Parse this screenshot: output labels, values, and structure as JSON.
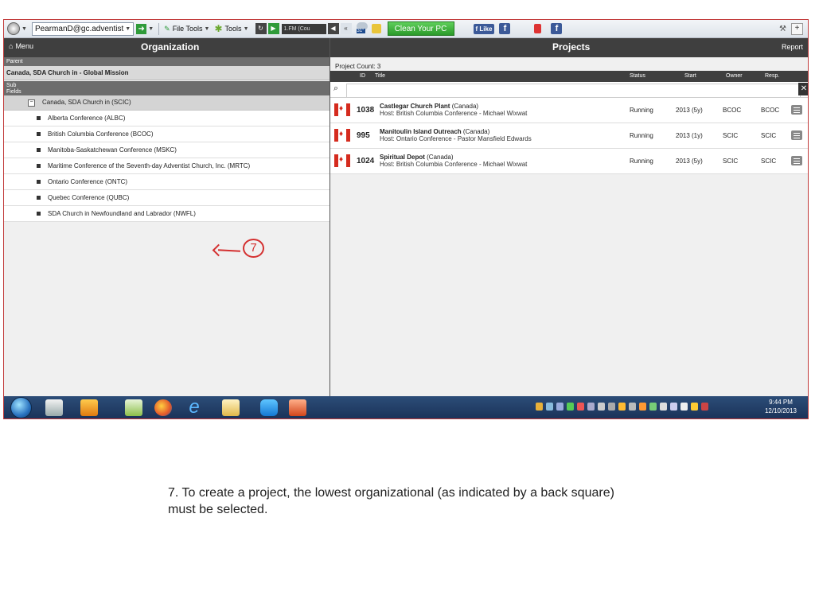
{
  "toolbar": {
    "account": "PearmanD@gc.adventist",
    "file_tools": "File Tools",
    "tools": "Tools",
    "radio": "1.FM (Cou",
    "temperature": "31°",
    "clean_pc": "Clean Your PC",
    "like": "Like"
  },
  "header": {
    "menu": "Menu",
    "organization": "Organization",
    "projects": "Projects",
    "report": "Report"
  },
  "left": {
    "parent_label": "Parent",
    "parent_value": "Canada, SDA Church in - Global Mission",
    "sub_label_1": "Sub",
    "sub_label_2": "Fields",
    "tree_parent": "Canada, SDA Church in (SCIC)",
    "items": [
      "Alberta Conference (ALBC)",
      "British Columbia Conference (BCOC)",
      "Manitoba-Saskatchewan Conference (MSKC)",
      "Maritime Conference of the Seventh-day Adventist Church, Inc. (MRTC)",
      "Ontario Conference (ONTC)",
      "Quebec Conference (QUBC)",
      "SDA Church in Newfoundland and Labrador (NWFL)"
    ]
  },
  "right": {
    "project_count": "Project Count: 3",
    "columns": {
      "id": "ID",
      "title": "Title",
      "status": "Status",
      "start": "Start",
      "owner": "Owner",
      "resp": "Resp."
    },
    "projects": [
      {
        "id": "1038",
        "title": "Castlegar Church Plant",
        "country": "(Canada)",
        "host": "Host: British Columbia Conference - Michael Wixwat",
        "status": "Running",
        "start": "2013 (5y)",
        "owner": "BCOC",
        "resp": "BCOC"
      },
      {
        "id": "995",
        "title": "Manitoulin Island Outreach",
        "country": "(Canada)",
        "host": "Host: Ontario Conference - Pastor Mansfield Edwards",
        "status": "Running",
        "start": "2013 (1y)",
        "owner": "SCIC",
        "resp": "SCIC"
      },
      {
        "id": "1024",
        "title": "Spiritual Depot",
        "country": "(Canada)",
        "host": "Host: British Columbia Conference - Michael Wixwat",
        "status": "Running",
        "start": "2013 (5y)",
        "owner": "SCIC",
        "resp": "SCIC"
      }
    ]
  },
  "taskbar": {
    "time": "9:44 PM",
    "date": "12/10/2013"
  },
  "annotation": {
    "marker": "7"
  },
  "caption": "7.  To create a project, the lowest organizational (as indicated by a back square) must be selected."
}
